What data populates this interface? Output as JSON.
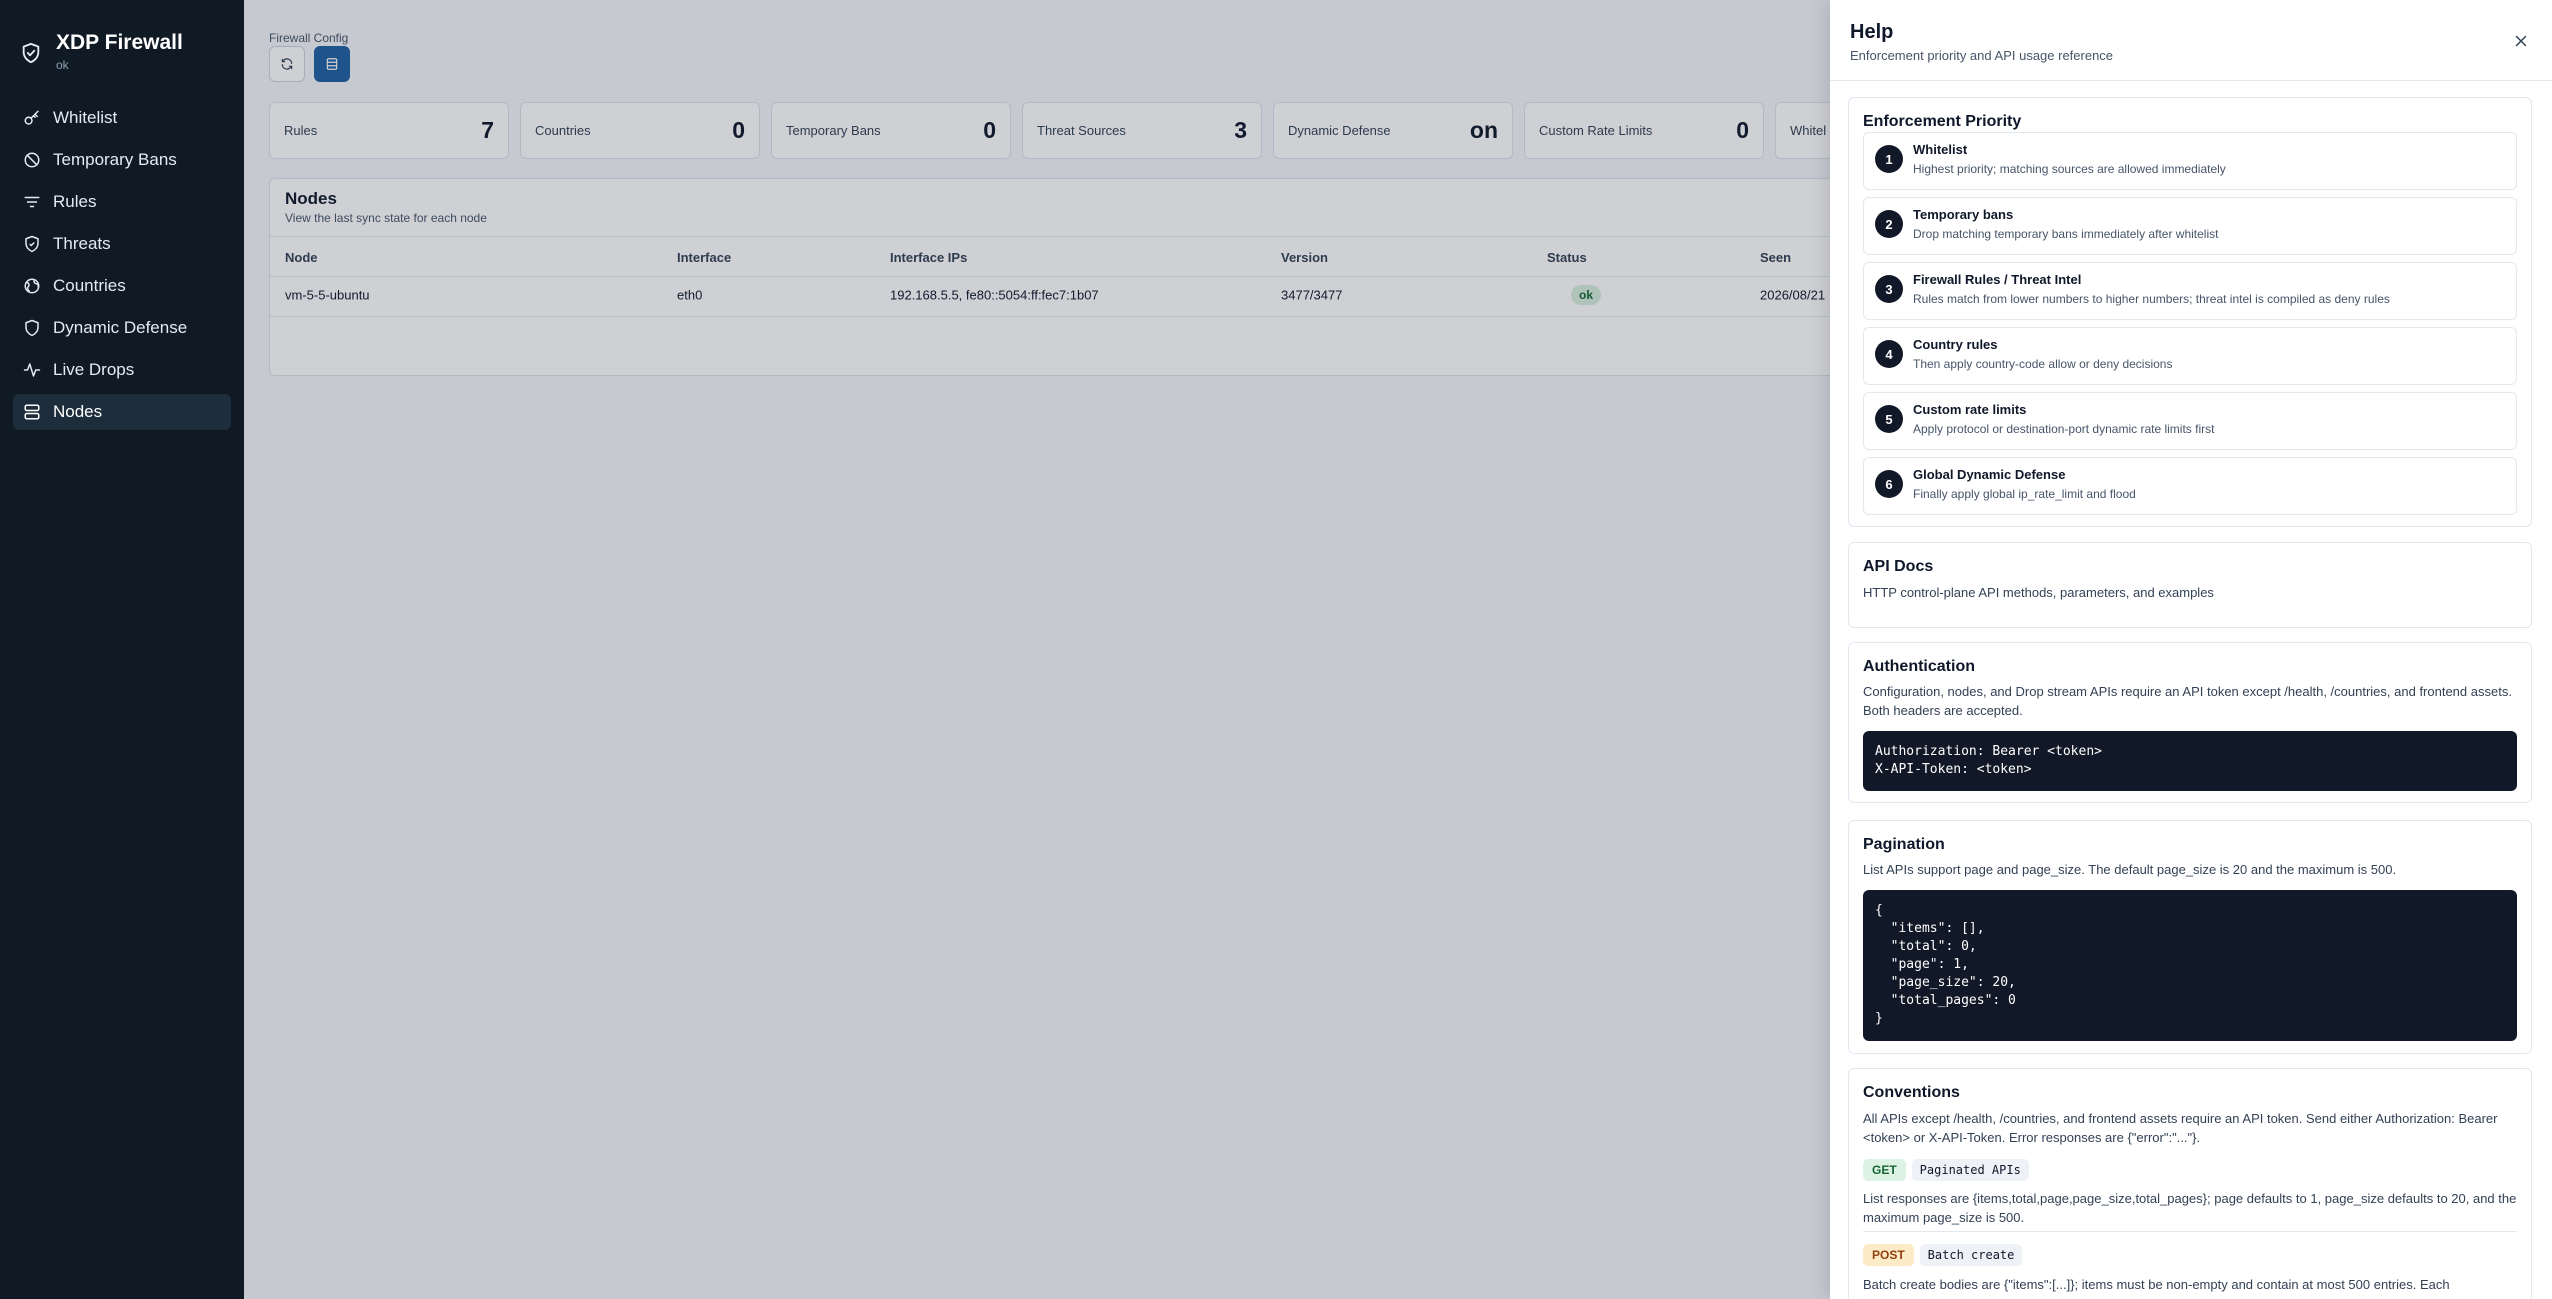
{
  "app": {
    "title": "XDP Firewall",
    "status": "ok"
  },
  "sidebar": {
    "items": [
      {
        "label": "Whitelist",
        "icon": "key-icon"
      },
      {
        "label": "Temporary Bans",
        "icon": "ban-icon"
      },
      {
        "label": "Rules",
        "icon": "filter-icon"
      },
      {
        "label": "Threats",
        "icon": "shield-icon"
      },
      {
        "label": "Countries",
        "icon": "globe-icon"
      },
      {
        "label": "Dynamic Defense",
        "icon": "shield-icon"
      },
      {
        "label": "Live Drops",
        "icon": "activity-icon"
      },
      {
        "label": "Nodes",
        "icon": "server-icon",
        "active": true
      }
    ]
  },
  "main": {
    "breadcrumb": "Firewall Config",
    "stats": [
      {
        "label": "Rules",
        "value": "7"
      },
      {
        "label": "Countries",
        "value": "0"
      },
      {
        "label": "Temporary Bans",
        "value": "0"
      },
      {
        "label": "Threat Sources",
        "value": "3"
      },
      {
        "label": "Dynamic Defense",
        "value": "on"
      },
      {
        "label": "Custom Rate Limits",
        "value": "0"
      },
      {
        "label": "Whitel",
        "value": ""
      }
    ],
    "nodes": {
      "title": "Nodes",
      "subtitle": "View the last sync state for each node",
      "columns": [
        "Node",
        "Interface",
        "Interface IPs",
        "Version",
        "Status",
        "Seen"
      ],
      "rows": [
        {
          "node": "vm-5-5-ubuntu",
          "interface": "eth0",
          "ips": "192.168.5.5, fe80::5054:ff:fec7:1b07",
          "version": "3477/3477",
          "status": "ok",
          "seen": "2026/08/21"
        }
      ]
    }
  },
  "help": {
    "title": "Help",
    "subtitle": "Enforcement priority and API usage reference",
    "priority": {
      "title": "Enforcement Priority",
      "items": [
        {
          "num": "1",
          "title": "Whitelist",
          "desc": "Highest priority; matching sources are allowed immediately"
        },
        {
          "num": "2",
          "title": "Temporary bans",
          "desc": "Drop matching temporary bans immediately after whitelist"
        },
        {
          "num": "3",
          "title": "Firewall Rules / Threat Intel",
          "desc": "Rules match from lower numbers to higher numbers; threat intel is compiled as deny rules"
        },
        {
          "num": "4",
          "title": "Country rules",
          "desc": "Then apply country-code allow or deny decisions"
        },
        {
          "num": "5",
          "title": "Custom rate limits",
          "desc": "Apply protocol or destination-port dynamic rate limits first"
        },
        {
          "num": "6",
          "title": "Global Dynamic Defense",
          "desc": "Finally apply global ip_rate_limit and flood"
        }
      ]
    },
    "api_docs": {
      "title": "API Docs",
      "desc": "HTTP control-plane API methods, parameters, and examples"
    },
    "auth": {
      "title": "Authentication",
      "desc": "Configuration, nodes, and Drop stream APIs require an API token except /health, /countries, and frontend assets. Both headers are accepted.",
      "code": "Authorization: Bearer <token>\nX-API-Token: <token>"
    },
    "pagination": {
      "title": "Pagination",
      "desc": "List APIs support page and page_size. The default page_size is 20 and the maximum is 500.",
      "code": "{\n  \"items\": [],\n  \"total\": 0,\n  \"page\": 1,\n  \"page_size\": 20,\n  \"total_pages\": 0\n}"
    },
    "conventions": {
      "title": "Conventions",
      "desc": "All APIs except /health, /countries, and frontend assets require an API token. Send either Authorization: Bearer <token> or X-API-Token. Error responses are {\"error\":\"...\"}.",
      "get_method": "GET",
      "get_endpoint": "Paginated APIs",
      "get_desc": "List responses are {items,total,page,page_size,total_pages}; page defaults to 1, page_size defaults to 20, and the maximum page_size is 500.",
      "post_method": "POST",
      "post_endpoint": "Batch create",
      "post_desc": "Batch create bodies are {\"items\":[...]}; items must be non-empty and contain at most 500 entries. Each"
    }
  }
}
